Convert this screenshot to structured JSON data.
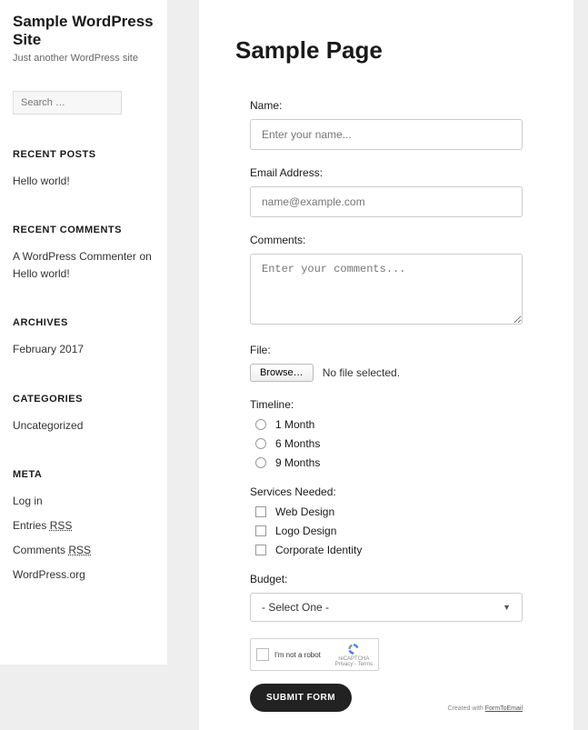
{
  "site": {
    "title": "Sample WordPress Site",
    "tagline": "Just another WordPress site"
  },
  "search": {
    "placeholder": "Search …"
  },
  "widgets": {
    "recent_posts": {
      "title": "RECENT POSTS",
      "items": [
        "Hello world!"
      ]
    },
    "recent_comments": {
      "title": "RECENT COMMENTS",
      "author": "A WordPress Commenter",
      "on": "on",
      "post": "Hello world!"
    },
    "archives": {
      "title": "ARCHIVES",
      "items": [
        "February 2017"
      ]
    },
    "categories": {
      "title": "CATEGORIES",
      "items": [
        "Uncategorized"
      ]
    },
    "meta": {
      "title": "META",
      "login": "Log in",
      "entries_prefix": "Entries ",
      "entries_rss": "RSS",
      "comments_prefix": "Comments ",
      "comments_rss": "RSS",
      "wporg": "WordPress.org"
    }
  },
  "page": {
    "title": "Sample Page"
  },
  "form": {
    "name": {
      "label": "Name:",
      "placeholder": "Enter your name..."
    },
    "email": {
      "label": "Email Address:",
      "placeholder": "name@example.com"
    },
    "comments": {
      "label": "Comments:",
      "placeholder": "Enter your comments..."
    },
    "file": {
      "label": "File:",
      "button": "Browse…",
      "status": "No file selected."
    },
    "timeline": {
      "label": "Timeline:",
      "options": [
        "1 Month",
        "6 Months",
        "9 Months"
      ]
    },
    "services": {
      "label": "Services Needed:",
      "options": [
        "Web Design",
        "Logo Design",
        "Corporate Identity"
      ]
    },
    "budget": {
      "label": "Budget:",
      "selected": "- Select One -"
    },
    "captcha": {
      "text": "I'm not a robot",
      "brand": "reCAPTCHA",
      "sub": "Privacy - Terms"
    },
    "submit": "SUBMIT FORM",
    "credit_prefix": "Created with ",
    "credit_link": "FormToEmail"
  }
}
